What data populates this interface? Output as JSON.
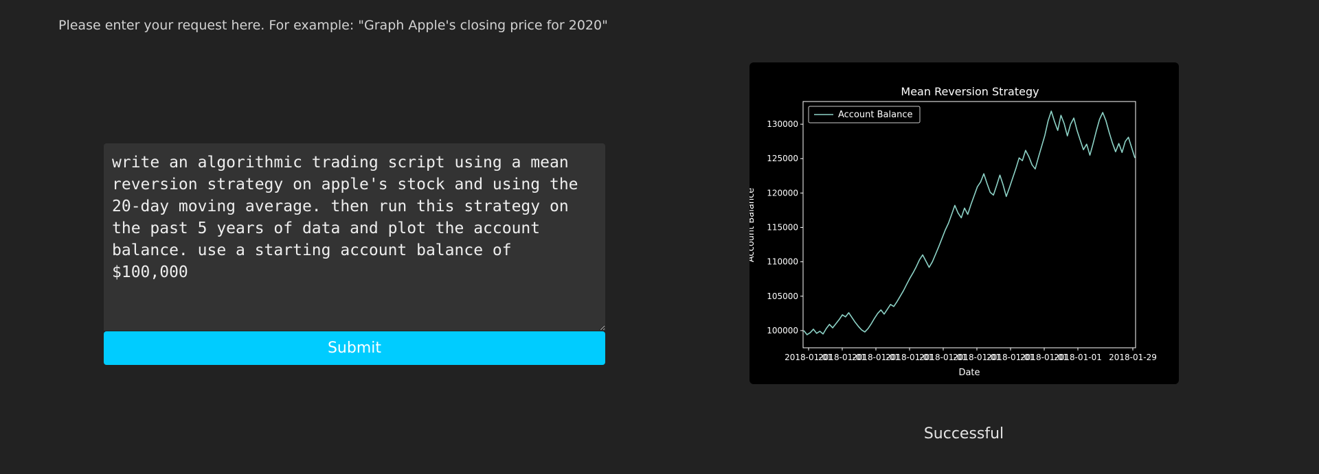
{
  "header": {
    "hint": "Please enter your request here. For example: \"Graph Apple's closing price for 2020\""
  },
  "form": {
    "request_text": "write an algorithmic trading script using a mean reversion strategy on apple's stock and using the 20-day moving average. then run this strategy on the past 5 years of data and plot the account balance. use a starting account balance of $100,000",
    "submit_label": "Submit"
  },
  "status": {
    "text": "Successful"
  },
  "colors": {
    "page_background": "#222222",
    "textarea_background": "#333333",
    "submit_button": "#00ccff",
    "chart_background": "#000000",
    "series_line": "#8dd3c7"
  },
  "chart_data": {
    "type": "line",
    "title": "Mean Reversion Strategy",
    "xlabel": "Date",
    "ylabel": "Account Balance",
    "legend_position": "top-left",
    "grid": false,
    "ylim": [
      97500,
      133300
    ],
    "y_ticks": [
      "100000",
      "105000",
      "110000",
      "115000",
      "120000",
      "125000",
      "130000"
    ],
    "x_tick_labels": [
      "2018-01-01",
      "2018-01-01",
      "2018-01-01",
      "2018-01-01",
      "2018-01-01",
      "2018-01-01",
      "2018-01-01",
      "2018-01-01",
      "2018-01-01",
      "2018-01-29"
    ],
    "series": [
      {
        "name": "Account Balance",
        "values": [
          100000,
          99400,
          99700,
          100200,
          99600,
          99900,
          99500,
          100300,
          100900,
          100400,
          101000,
          101600,
          102300,
          102000,
          102600,
          101900,
          101200,
          100600,
          100100,
          99800,
          100300,
          101000,
          101800,
          102500,
          103000,
          102400,
          103100,
          103800,
          103500,
          104200,
          105000,
          105800,
          106700,
          107600,
          108400,
          109300,
          110300,
          111000,
          110100,
          109200,
          110000,
          111100,
          112200,
          113400,
          114600,
          115600,
          116900,
          118200,
          117100,
          116400,
          117800,
          116900,
          118300,
          119600,
          120900,
          121600,
          122800,
          121400,
          120100,
          119700,
          121100,
          122600,
          121200,
          119500,
          120800,
          122200,
          123600,
          125100,
          124700,
          126200,
          125300,
          124100,
          123500,
          125200,
          126800,
          128400,
          130500,
          131900,
          130400,
          129100,
          131300,
          130100,
          128300,
          130000,
          130900,
          129100,
          127700,
          126300,
          127100,
          125500,
          127200,
          129000,
          130700,
          131700,
          130500,
          128800,
          127300,
          126000,
          127200,
          125900,
          127500,
          128100,
          126600,
          125100
        ]
      }
    ]
  }
}
